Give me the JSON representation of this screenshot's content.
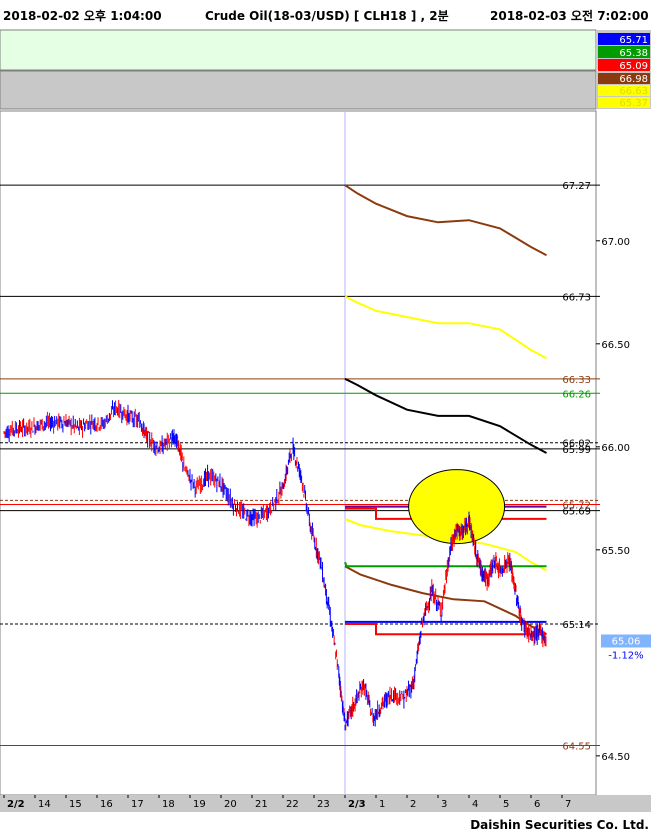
{
  "header": {
    "start_time": "2018-02-02 오후 1:04:00",
    "title": "Crude Oil(18-03/USD)  [ CLH18 ] , 2분",
    "end_time": "2018-02-03 오전 7:02:00"
  },
  "footer": {
    "brand": "Daishin Securities Co. Ltd."
  },
  "colors": {
    "top_panel_bg": "#e4ffe4",
    "second_panel_bg": "#c8c8c8",
    "axis_bg": "#c8c8c8",
    "up_candle": "#ff0000",
    "down_candle": "#0000ff",
    "highlight_circle": "#ffff00",
    "current_price_box": "#80b4ff"
  },
  "panels": {
    "top_labels": [
      {
        "text": "65.71",
        "bg": "#0000ff",
        "fg": "#ffffff"
      },
      {
        "text": "65.38",
        "bg": "#009c00",
        "fg": "#ffffff"
      },
      {
        "text": "65.09",
        "bg": "#ff0000",
        "fg": "#ffffff"
      }
    ],
    "second_labels": [
      {
        "text": "66.98",
        "bg": "#8b3a0f",
        "fg": "#ffffff"
      },
      {
        "text": "66.63",
        "bg": "#ffff00",
        "fg": "#dddd00"
      },
      {
        "text": "65.37",
        "bg": "#ffff00",
        "fg": "#dddd00"
      }
    ]
  },
  "chart_data": {
    "type": "candlestick",
    "y_ticks": [
      "67.00",
      "66.50",
      "66.00",
      "65.50",
      "64.50"
    ],
    "x_ticks": [
      "2/2",
      "14",
      "15",
      "16",
      "17",
      "18",
      "19",
      "20",
      "21",
      "22",
      "23",
      "2/3",
      "1",
      "2",
      "3",
      "4",
      "5",
      "6",
      "7"
    ],
    "ylim": [
      64.31,
      67.63
    ],
    "level_labels": [
      {
        "text": "67.27",
        "value": 67.27,
        "color": "#000000"
      },
      {
        "text": "66.73",
        "value": 66.73,
        "color": "#000000"
      },
      {
        "text": "66.33",
        "value": 66.33,
        "color": "#8b3a0f"
      },
      {
        "text": "66.26",
        "value": 66.26,
        "color": "#009c00"
      },
      {
        "text": "66.02",
        "value": 66.02,
        "color": "#000000"
      },
      {
        "text": "65.99",
        "value": 65.99,
        "color": "#000000"
      },
      {
        "text": "65.72",
        "value": 65.72,
        "color": "#8b3a0f"
      },
      {
        "text": "65.69",
        "value": 65.69,
        "color": "#000000"
      },
      {
        "text": "65.14",
        "value": 65.14,
        "color": "#000000"
      },
      {
        "text": "64.55",
        "value": 64.55,
        "color": "#8b3a0f"
      }
    ],
    "current_price": "65.06",
    "current_change": "-1.12%",
    "horizontal_lines": [
      {
        "value": 67.27,
        "color": "#000000",
        "dashed": false
      },
      {
        "value": 66.73,
        "color": "#000000",
        "dashed": false
      },
      {
        "value": 66.33,
        "color": "#8b3a0f",
        "dashed": false
      },
      {
        "value": 66.26,
        "color": "#009c00",
        "dashed": false
      },
      {
        "value": 66.02,
        "color": "#000000",
        "dashed": true
      },
      {
        "value": 65.99,
        "color": "#000000",
        "dashed": false
      },
      {
        "value": 65.74,
        "color": "#8b3a0f",
        "dashed": true
      },
      {
        "value": 65.72,
        "color": "#ff0000",
        "dashed": false
      },
      {
        "value": 65.69,
        "color": "#000000",
        "dashed": false
      },
      {
        "value": 65.14,
        "color": "#000000",
        "dashed": true
      },
      {
        "value": 64.55,
        "color": "#8b3a0f",
        "dashed": false
      }
    ],
    "series": [
      {
        "color": "#8b3a0f",
        "points": [
          [
            11.0,
            67.27
          ],
          [
            11.4,
            67.23
          ],
          [
            12.0,
            67.18
          ],
          [
            13.0,
            67.12
          ],
          [
            14.0,
            67.09
          ],
          [
            15.0,
            67.1
          ],
          [
            16.0,
            67.06
          ],
          [
            17.0,
            66.97
          ],
          [
            17.5,
            66.93
          ]
        ]
      },
      {
        "color": "#ffff00",
        "points": [
          [
            11.0,
            66.73
          ],
          [
            11.4,
            66.7
          ],
          [
            12.0,
            66.66
          ],
          [
            13.0,
            66.63
          ],
          [
            14.0,
            66.6
          ],
          [
            15.0,
            66.6
          ],
          [
            16.0,
            66.57
          ],
          [
            17.0,
            66.47
          ],
          [
            17.5,
            66.43
          ]
        ]
      },
      {
        "color": "#000000",
        "points": [
          [
            11.0,
            66.33
          ],
          [
            11.4,
            66.3
          ],
          [
            12.0,
            66.25
          ],
          [
            13.0,
            66.18
          ],
          [
            14.0,
            66.15
          ],
          [
            15.0,
            66.15
          ],
          [
            16.0,
            66.1
          ],
          [
            17.0,
            66.01
          ],
          [
            17.5,
            65.97
          ]
        ]
      },
      {
        "color": "#ffff00",
        "points": [
          [
            11.0,
            65.65
          ],
          [
            11.5,
            65.62
          ],
          [
            12.5,
            65.59
          ],
          [
            13.5,
            65.57
          ],
          [
            14.5,
            65.55
          ],
          [
            15.5,
            65.53
          ],
          [
            16.5,
            65.49
          ],
          [
            17.0,
            65.44
          ],
          [
            17.5,
            65.4
          ]
        ]
      },
      {
        "color": "#8b3a0f",
        "points": [
          [
            11.0,
            65.42
          ],
          [
            11.5,
            65.38
          ],
          [
            12.5,
            65.33
          ],
          [
            13.5,
            65.29
          ],
          [
            14.5,
            65.26
          ],
          [
            15.5,
            65.25
          ],
          [
            16.5,
            65.18
          ],
          [
            17.0,
            65.13
          ],
          [
            17.5,
            65.09
          ]
        ]
      },
      {
        "color": "#009c00",
        "points": [
          [
            11.0,
            65.44
          ],
          [
            11.05,
            65.42
          ],
          [
            17.5,
            65.42
          ]
        ]
      },
      {
        "color": "#ff0000",
        "points": [
          [
            11.0,
            65.7
          ],
          [
            12.0,
            65.7
          ],
          [
            12.0,
            65.65
          ],
          [
            17.5,
            65.65
          ]
        ]
      },
      {
        "color": "#ff0000",
        "points": [
          [
            11.0,
            65.14
          ],
          [
            12.0,
            65.14
          ],
          [
            12.0,
            65.09
          ],
          [
            17.5,
            65.09
          ]
        ]
      },
      {
        "color": "#0000ff",
        "points": [
          [
            11.0,
            65.15
          ],
          [
            17.5,
            65.15
          ]
        ]
      },
      {
        "color": "#660099",
        "points": [
          [
            11.0,
            65.71
          ],
          [
            17.5,
            65.71
          ]
        ]
      }
    ],
    "price_path": [
      [
        0.0,
        66.07
      ],
      [
        0.4,
        66.09
      ],
      [
        0.8,
        66.09
      ],
      [
        1.2,
        66.11
      ],
      [
        1.6,
        66.12
      ],
      [
        2.0,
        66.12
      ],
      [
        2.4,
        66.09
      ],
      [
        2.8,
        66.12
      ],
      [
        3.2,
        66.11
      ],
      [
        3.6,
        66.19
      ],
      [
        4.0,
        66.15
      ],
      [
        4.4,
        66.12
      ],
      [
        4.6,
        66.05
      ],
      [
        5.0,
        65.99
      ],
      [
        5.4,
        66.04
      ],
      [
        5.6,
        66.03
      ],
      [
        5.8,
        65.9
      ],
      [
        6.2,
        65.8
      ],
      [
        6.6,
        65.86
      ],
      [
        7.0,
        65.82
      ],
      [
        7.4,
        65.72
      ],
      [
        7.8,
        65.67
      ],
      [
        8.2,
        65.65
      ],
      [
        8.6,
        65.7
      ],
      [
        9.0,
        65.8
      ],
      [
        9.3,
        66.0
      ],
      [
        9.6,
        65.85
      ],
      [
        9.9,
        65.6
      ],
      [
        10.2,
        65.45
      ],
      [
        10.5,
        65.2
      ],
      [
        10.8,
        64.9
      ],
      [
        11.0,
        64.65
      ],
      [
        11.3,
        64.75
      ],
      [
        11.6,
        64.85
      ],
      [
        11.9,
        64.68
      ],
      [
        12.2,
        64.75
      ],
      [
        12.5,
        64.8
      ],
      [
        12.9,
        64.78
      ],
      [
        13.2,
        64.85
      ],
      [
        13.5,
        65.15
      ],
      [
        13.8,
        65.3
      ],
      [
        14.1,
        65.2
      ],
      [
        14.4,
        65.5
      ],
      [
        14.6,
        65.6
      ],
      [
        14.8,
        65.58
      ],
      [
        15.0,
        65.65
      ],
      [
        15.2,
        65.5
      ],
      [
        15.4,
        65.4
      ],
      [
        15.6,
        65.35
      ],
      [
        15.8,
        65.45
      ],
      [
        16.0,
        65.4
      ],
      [
        16.3,
        65.45
      ],
      [
        16.5,
        65.3
      ],
      [
        16.7,
        65.15
      ],
      [
        17.0,
        65.08
      ],
      [
        17.3,
        65.1
      ],
      [
        17.5,
        65.06
      ]
    ],
    "highlight_circle": {
      "x": 14.6,
      "value": 65.71
    }
  }
}
